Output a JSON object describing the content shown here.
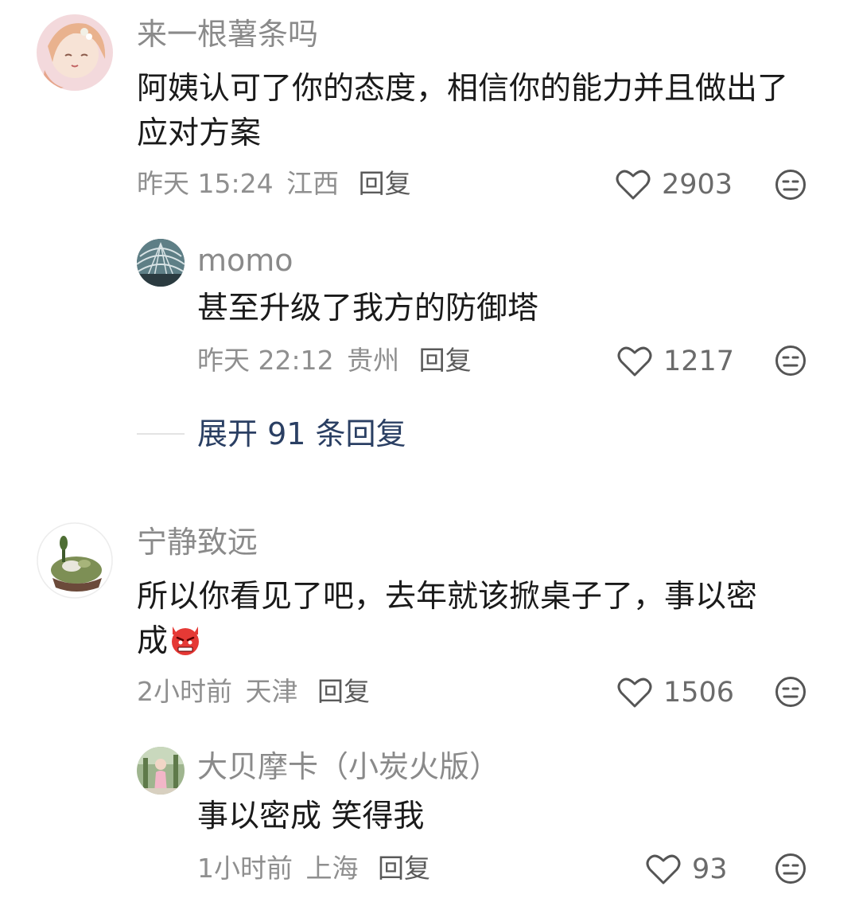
{
  "comments": [
    {
      "username": "来一根薯条吗",
      "text": "阿姨认可了你的态度，相信你的能力并且做出了应对方案",
      "time": "昨天 15:24",
      "location": "江西",
      "reply_label": "回复",
      "likes": "2903",
      "avatar_icon": "anime-girl-avatar",
      "replies": [
        {
          "username": "momo",
          "text": "甚至升级了我方的防御塔",
          "time": "昨天 22:12",
          "location": "贵州",
          "reply_label": "回复",
          "likes": "1217",
          "avatar_icon": "glass-dome-avatar"
        }
      ],
      "expand_label": "展开 91 条回复"
    },
    {
      "username": "宁静致远",
      "text_line1": "所以你看见了吧，去年就该掀桌子了，事以密",
      "text_line2": "成",
      "text_emoji": "angry-devil-emoji",
      "time": "2小时前",
      "location": "天津",
      "reply_label": "回复",
      "likes": "1506",
      "avatar_icon": "moss-bonsai-avatar",
      "replies": [
        {
          "username": "大贝摩卡（小炭火版）",
          "text": "事以密成 笑得我",
          "time": "1小时前",
          "location": "上海",
          "reply_label": "回复",
          "likes": "93",
          "avatar_icon": "photo-person-avatar"
        }
      ]
    }
  ],
  "colors": {
    "username": "#8a8a8a",
    "text": "#1a1a1a",
    "meta": "#8f8f8f",
    "expand": "#2a3f63"
  }
}
